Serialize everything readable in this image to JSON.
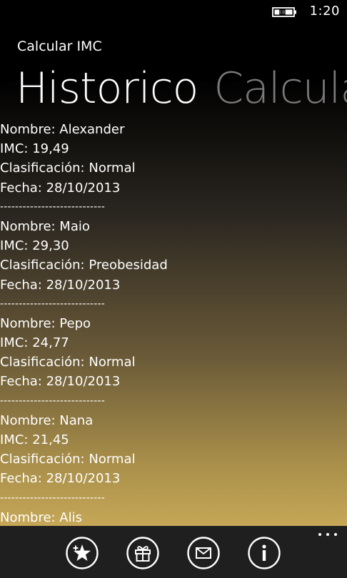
{
  "status_bar": {
    "time": "1:20",
    "battery_icon": "battery-charging-icon"
  },
  "app": {
    "title": "Calcular IMC"
  },
  "pivot": {
    "items": [
      {
        "label": "Historico",
        "selected": true
      },
      {
        "label": "Calcular",
        "selected": false
      }
    ]
  },
  "history": {
    "separator": "----------------------------",
    "records": [
      {
        "nombre": "Nombre: Alexander",
        "imc": "IMC: 19,49",
        "clasificacion": "Clasificación: Normal",
        "fecha": "Fecha: 28/10/2013"
      },
      {
        "nombre": "Nombre: Maio",
        "imc": "IMC: 29,30",
        "clasificacion": "Clasificación: Preobesidad",
        "fecha": "Fecha: 28/10/2013"
      },
      {
        "nombre": "Nombre: Pepo",
        "imc": "IMC: 24,77",
        "clasificacion": "Clasificación: Normal",
        "fecha": "Fecha: 28/10/2013"
      },
      {
        "nombre": "Nombre: Nana",
        "imc": "IMC: 21,45",
        "clasificacion": "Clasificación: Normal",
        "fecha": "Fecha: 28/10/2013"
      },
      {
        "nombre": "Nombre: Alis"
      }
    ]
  },
  "app_bar": {
    "buttons": [
      {
        "icon": "star-add-icon"
      },
      {
        "icon": "gift-icon"
      },
      {
        "icon": "mail-icon"
      },
      {
        "icon": "info-icon"
      }
    ],
    "more_icon": "more-dots-icon"
  },
  "colors": {
    "accent_gold": "#c9ab5a",
    "app_bar": "#1f1f1f",
    "inactive_pivot": "#7a7a7a"
  }
}
